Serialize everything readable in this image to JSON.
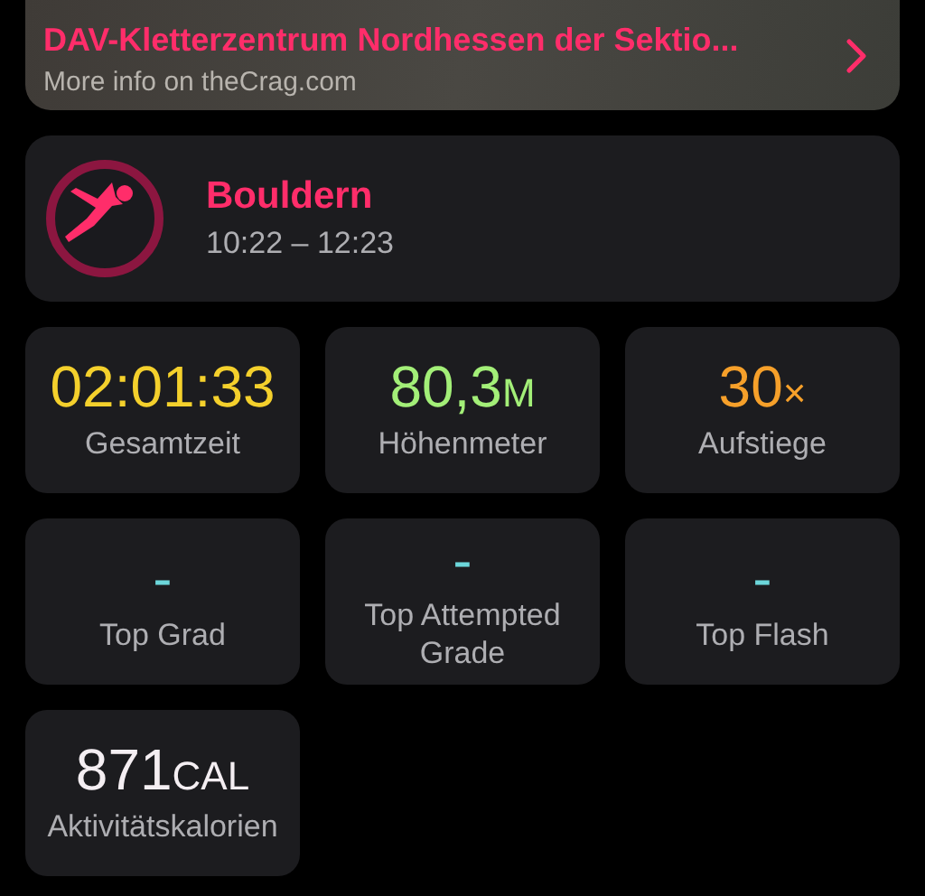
{
  "location": {
    "title": "DAV-Kletterzentrum Nordhessen der Sektio...",
    "subtitle": "More info on theCrag.com"
  },
  "workout": {
    "title": "Bouldern",
    "time": "10:22 – 12:23"
  },
  "stats": [
    {
      "value": "02:01:33",
      "label": "Gesamtzeit",
      "color": "#f4d02c"
    },
    {
      "value": "80,3",
      "unit": "M",
      "label": "Höhenmeter",
      "color": "#a3ef78"
    },
    {
      "value": "30",
      "unit": "×",
      "label": "Aufstiege",
      "color": "#f6a02a"
    },
    {
      "value": "-",
      "label": "Top Grad",
      "color": "#6cd6da"
    },
    {
      "value": "-",
      "label": "Top Attempted Grade",
      "color": "#6cd6da"
    },
    {
      "value": "-",
      "label": "Top Flash",
      "color": "#6cd6da"
    },
    {
      "value": "871",
      "unit": "CAL",
      "label": "Aktivitätskalorien",
      "color": "#f4eef2"
    }
  ]
}
